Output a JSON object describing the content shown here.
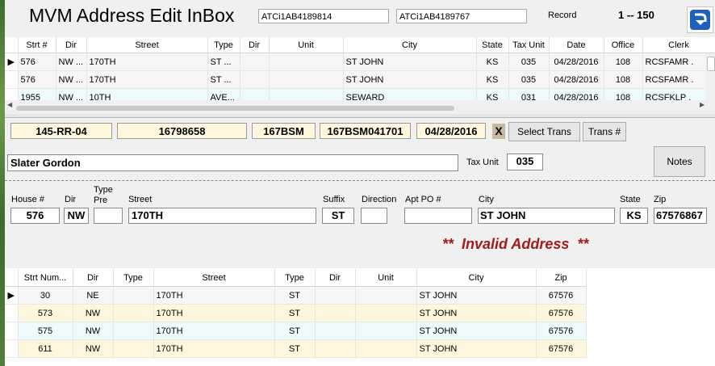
{
  "app": {
    "title": "MVM Address Edit InBox",
    "id_field_1": "ATCi1AB4189814",
    "id_field_2": "ATCi1AB4189767",
    "record_label": "Record",
    "record_range": "1 -- 150"
  },
  "top_grid": {
    "columns": [
      "Strt #",
      "Dir",
      "Street",
      "Type",
      "Dir",
      "Unit",
      "City",
      "State",
      "Tax Unit",
      "Date",
      "Office",
      "Clerk"
    ],
    "rows": [
      [
        "576",
        "NW ...",
        "170TH",
        "ST ...",
        "",
        "",
        "ST JOHN",
        "KS",
        "035",
        "04/28/2016",
        "108",
        "RCSFAMR ."
      ],
      [
        "576",
        "NW ...",
        "170TH",
        "ST ...",
        "",
        "",
        "ST JOHN",
        "KS",
        "035",
        "04/28/2016",
        "108",
        "RCSFAMR ."
      ],
      [
        "1955",
        "NW ...",
        "10TH",
        "AVE...",
        "",
        "",
        "SEWARD",
        "KS",
        "031",
        "04/28/2016",
        "108",
        "RCSFKLP ."
      ]
    ]
  },
  "detail": {
    "field1": "145-RR-04",
    "field2": "16798658",
    "field3": "167BSM",
    "field4": "167BSM041701",
    "field5": "04/28/2016",
    "clear_label": "X",
    "select_trans_label": "Select Trans",
    "trans_num_label": "Trans #",
    "name": "Slater Gordon",
    "tax_unit_label": "Tax Unit",
    "tax_unit_value": "035",
    "notes_label": "Notes"
  },
  "address": {
    "labels": {
      "house": "House #",
      "dir": "Dir",
      "type_pre": "Type\nPre",
      "street": "Street",
      "suffix": "Suffix",
      "direction": "Direction",
      "apt": "Apt PO #",
      "city": "City",
      "state": "State",
      "zip": "Zip"
    },
    "values": {
      "house": "576",
      "dir": "NW",
      "type_pre": "",
      "street": "170TH",
      "suffix": "ST",
      "direction": "",
      "apt": "",
      "city": "ST JOHN",
      "state": "KS",
      "zip": "67576867"
    },
    "status": "**  Invalid Address  **"
  },
  "bottom_grid": {
    "columns": [
      "Strt Num...",
      "Dir",
      "Type",
      "Street",
      "Type",
      "Dir",
      "Unit",
      "City",
      "Zip"
    ],
    "rows": [
      [
        "30",
        "NE",
        "",
        "170TH",
        "ST",
        "",
        "",
        "ST JOHN",
        "67576"
      ],
      [
        "573",
        "NW",
        "",
        "170TH",
        "ST",
        "",
        "",
        "ST JOHN",
        "67576"
      ],
      [
        "575",
        "NW",
        "",
        "170TH",
        "ST",
        "",
        "",
        "ST JOHN",
        "67576"
      ],
      [
        "611",
        "NW",
        "",
        "170TH",
        "ST",
        "",
        "",
        "ST JOHN",
        "67576"
      ]
    ]
  },
  "colors": {
    "field_yellow": "#fef7dd",
    "row_cyan": "#eefbfc",
    "invalid_red": "#a31a1a",
    "back_icon_blue": "#1f5fbf"
  },
  "icons": {
    "back": "back-arrow-icon",
    "row_pointer": "row-pointer-icon",
    "scroll_up": "scroll-up-icon",
    "scroll_left": "scroll-left-icon",
    "scroll_right": "scroll-right-icon"
  }
}
